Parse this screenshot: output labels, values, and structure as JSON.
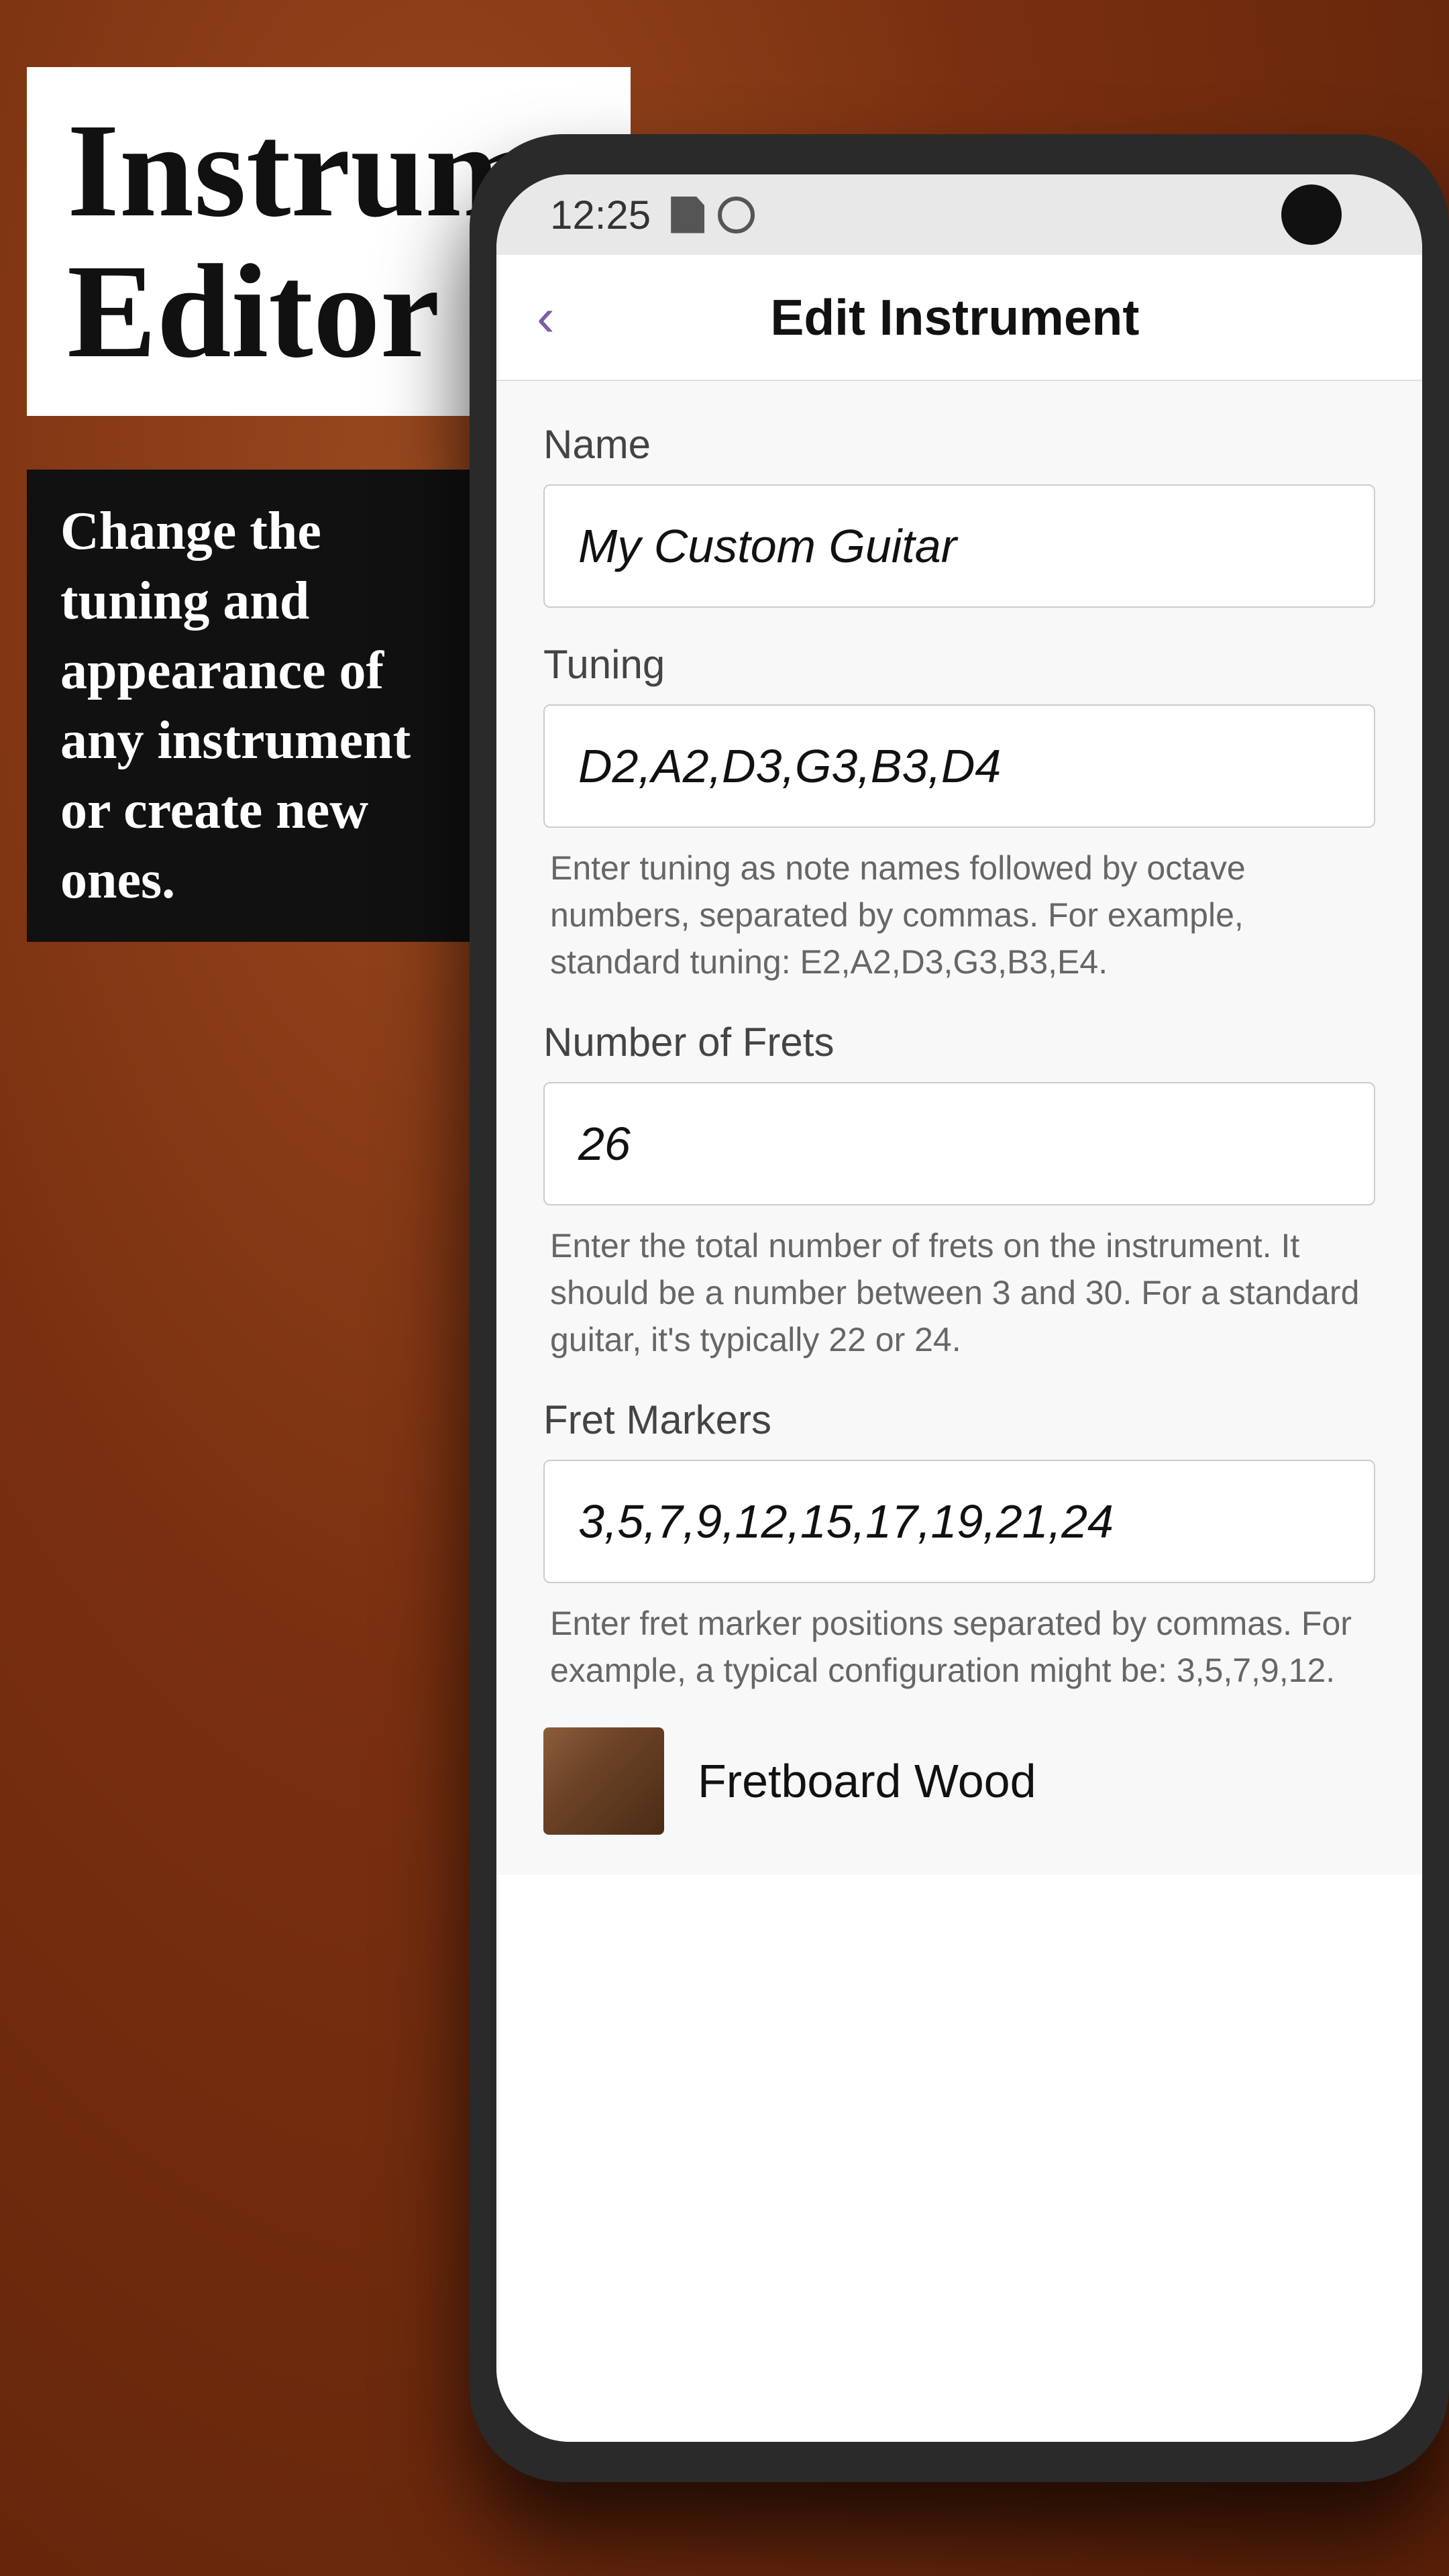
{
  "background": {
    "color": "#7a3010"
  },
  "app_title": {
    "line1": "Instrument",
    "line2": "Editor"
  },
  "description": {
    "text": "Change the tuning and appearance of any instrument or create new ones."
  },
  "status_bar": {
    "time": "12:25"
  },
  "nav": {
    "back_label": "‹",
    "title": "Edit Instrument"
  },
  "form": {
    "name_label": "Name",
    "name_value": "My Custom Guitar",
    "tuning_label": "Tuning",
    "tuning_value": "D2,A2,D3,G3,B3,D4",
    "tuning_helper": "Enter tuning as note names followed by octave numbers, separated by commas. For example, standard tuning: E2,A2,D3,G3,B3,E4.",
    "frets_label": "Number of Frets",
    "frets_value": "26",
    "frets_helper": "Enter the total number of frets on the instrument. It should be a number between 3 and 30. For a standard guitar, it's typically 22 or 24.",
    "fret_markers_label": "Fret Markers",
    "fret_markers_value": "3,5,7,9,12,15,17,19,21,24",
    "fret_markers_helper": "Enter fret marker positions separated by commas. For example, a typical configuration might be: 3,5,7,9,12.",
    "fretboard_wood_label": "Fretboard Wood"
  }
}
